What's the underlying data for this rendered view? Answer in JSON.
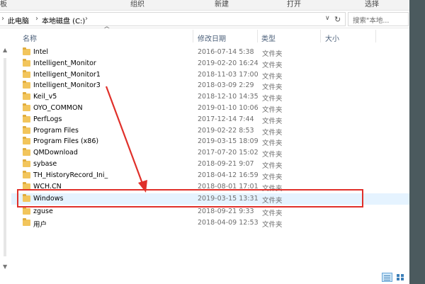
{
  "ribbon": {
    "groups": [
      "板",
      "组织",
      "新建",
      "打开",
      "选择"
    ]
  },
  "address": {
    "crumbs": [
      "此电脑",
      "本地磁盘 (C:)"
    ],
    "separator": "›",
    "dropdown_glyph": "∨",
    "refresh_glyph": "↻"
  },
  "search": {
    "placeholder": "搜索\"本地..."
  },
  "columns": {
    "name": "名称",
    "date": "修改日期",
    "type": "类型",
    "size": "大小"
  },
  "files": [
    {
      "name": "Intel",
      "date": "2016-07-14 5:38",
      "type": "文件夹"
    },
    {
      "name": "Intelligent_Monitor",
      "date": "2019-02-20 16:24",
      "type": "文件夹"
    },
    {
      "name": "Intelligent_Monitor1",
      "date": "2018-11-03 17:00",
      "type": "文件夹"
    },
    {
      "name": "Intelligent_Monitor3",
      "date": "2018-03-09 2:29",
      "type": "文件夹"
    },
    {
      "name": "Keil_v5",
      "date": "2018-12-10 14:35",
      "type": "文件夹"
    },
    {
      "name": "OYO_COMMON",
      "date": "2019-01-10 10:06",
      "type": "文件夹"
    },
    {
      "name": "PerfLogs",
      "date": "2017-12-14 7:44",
      "type": "文件夹"
    },
    {
      "name": "Program Files",
      "date": "2019-02-22 8:53",
      "type": "文件夹"
    },
    {
      "name": "Program Files (x86)",
      "date": "2019-03-15 18:09",
      "type": "文件夹"
    },
    {
      "name": "QMDownload",
      "date": "2017-07-20 15:02",
      "type": "文件夹"
    },
    {
      "name": "sybase",
      "date": "2018-09-21 9:07",
      "type": "文件夹"
    },
    {
      "name": "TH_HistoryRecord_Ini_",
      "date": "2018-04-12 16:59",
      "type": "文件夹"
    },
    {
      "name": "WCH.CN",
      "date": "2018-08-01 17:01",
      "type": "文件夹"
    },
    {
      "name": "Windows",
      "date": "2019-03-15 13:31",
      "type": "文件夹"
    },
    {
      "name": "zguse",
      "date": "2018-09-21 9:33",
      "type": "文件夹"
    },
    {
      "name": "用户",
      "date": "2018-04-09 12:53",
      "type": "文件夹"
    }
  ],
  "selected_file": "Windows",
  "colors": {
    "highlight_box": "#e0302a",
    "selection": "#e5f3ff",
    "folder": "#f2c55c",
    "header_text": "#4c607a"
  }
}
